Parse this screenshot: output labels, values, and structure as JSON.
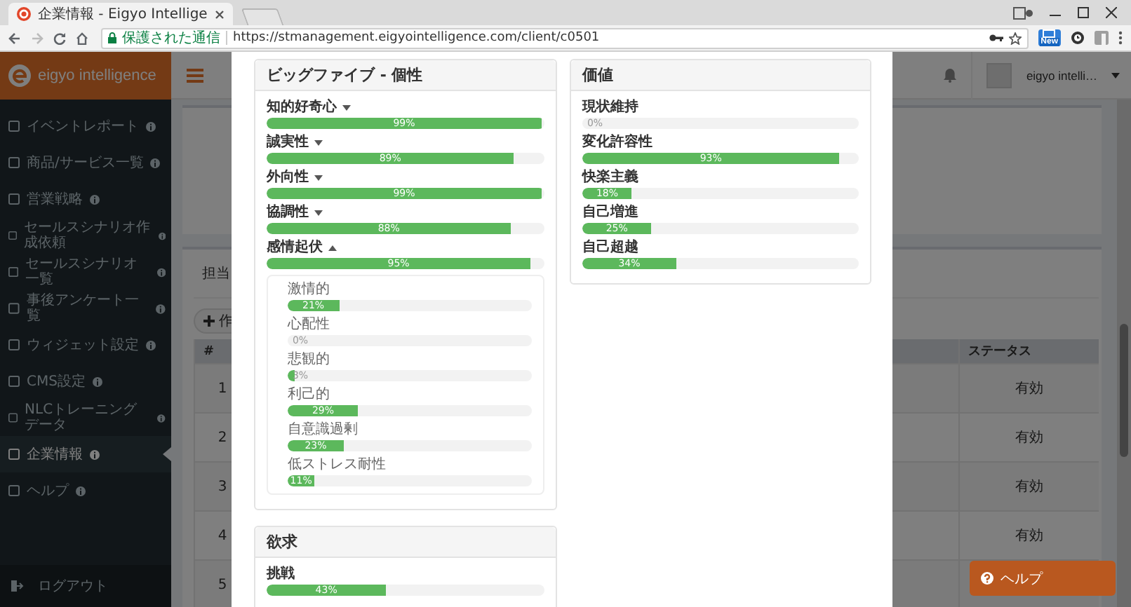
{
  "browser": {
    "tab_title": "企業情報 - Eigyo Intellige",
    "security_label": "保護された通信",
    "url": "https://stmanagement.eigyointelligence.com/client/c0501",
    "extension_badge": "New"
  },
  "header": {
    "logo": "eigyo intelligence",
    "user_name": "eigyo intelli…"
  },
  "sidebar": {
    "items": [
      {
        "label": "イベントレポート",
        "selected": false
      },
      {
        "label": "商品/サービス一覧",
        "selected": false
      },
      {
        "label": "営業戦略",
        "selected": false
      },
      {
        "label": "セールスシナリオ作成依頼",
        "selected": false
      },
      {
        "label": "セールスシナリオ一覧",
        "selected": false
      },
      {
        "label": "事後アンケート一覧",
        "selected": false
      },
      {
        "label": "ウィジェット設定",
        "selected": false
      },
      {
        "label": "CMS設定",
        "selected": false
      },
      {
        "label": "NLCトレーニングデータ",
        "selected": false
      },
      {
        "label": "企業情報",
        "selected": true
      },
      {
        "label": "ヘルプ",
        "selected": false
      }
    ],
    "logout": "ログアウト"
  },
  "content": {
    "filter_label": "担当",
    "create_button": "作",
    "table": {
      "columns": [
        "#",
        "ステータス"
      ],
      "rows": [
        {
          "number": "1",
          "status": "有効"
        },
        {
          "number": "2",
          "status": "有効"
        },
        {
          "number": "3",
          "status": "有効"
        },
        {
          "number": "4",
          "status": "有効"
        },
        {
          "number": "5"
        }
      ]
    }
  },
  "modal": {
    "columns": [
      {
        "cards": [
          {
            "title": "ビッグファイブ - 個性",
            "traits": [
              {
                "label": "知的好奇心",
                "expanded": false,
                "level": 0.99,
                "reading": "99%"
              },
              {
                "label": "誠実性",
                "expanded": false,
                "level": 0.89,
                "reading": "89%"
              },
              {
                "label": "外向性",
                "expanded": false,
                "level": 0.99,
                "reading": "99%"
              },
              {
                "label": "協調性",
                "expanded": false,
                "level": 0.88,
                "reading": "88%"
              },
              {
                "label": "感情起伏",
                "expanded": true,
                "level": 0.95,
                "reading": "95%",
                "children": [
                  {
                    "label": "激情的",
                    "level": 0.21,
                    "reading": "21%"
                  },
                  {
                    "label": "心配性",
                    "level": 0,
                    "reading": "0%"
                  },
                  {
                    "label": "悲観的",
                    "level": 0.03,
                    "reading": "3%"
                  },
                  {
                    "label": "利己的",
                    "level": 0.29,
                    "reading": "29%"
                  },
                  {
                    "label": "自意識過剰",
                    "level": 0.23,
                    "reading": "23%"
                  },
                  {
                    "label": "低ストレス耐性",
                    "level": 0.11,
                    "reading": "11%"
                  }
                ]
              }
            ]
          },
          {
            "title": "欲求",
            "traits": [
              {
                "label": "挑戦",
                "level": 0.43,
                "reading": "43%"
              }
            ]
          }
        ]
      },
      {
        "cards": [
          {
            "title": "価値",
            "traits": [
              {
                "label": "現状維持",
                "level": 0,
                "reading": "0%"
              },
              {
                "label": "変化許容性",
                "level": 0.93,
                "reading": "93%"
              },
              {
                "label": "快楽主義",
                "level": 0.18,
                "reading": "18%"
              },
              {
                "label": "自己増進",
                "level": 0.25,
                "reading": "25%"
              },
              {
                "label": "自己超越",
                "level": 0.34,
                "reading": "34%"
              }
            ]
          }
        ]
      }
    ]
  },
  "help_button": "ヘルプ"
}
